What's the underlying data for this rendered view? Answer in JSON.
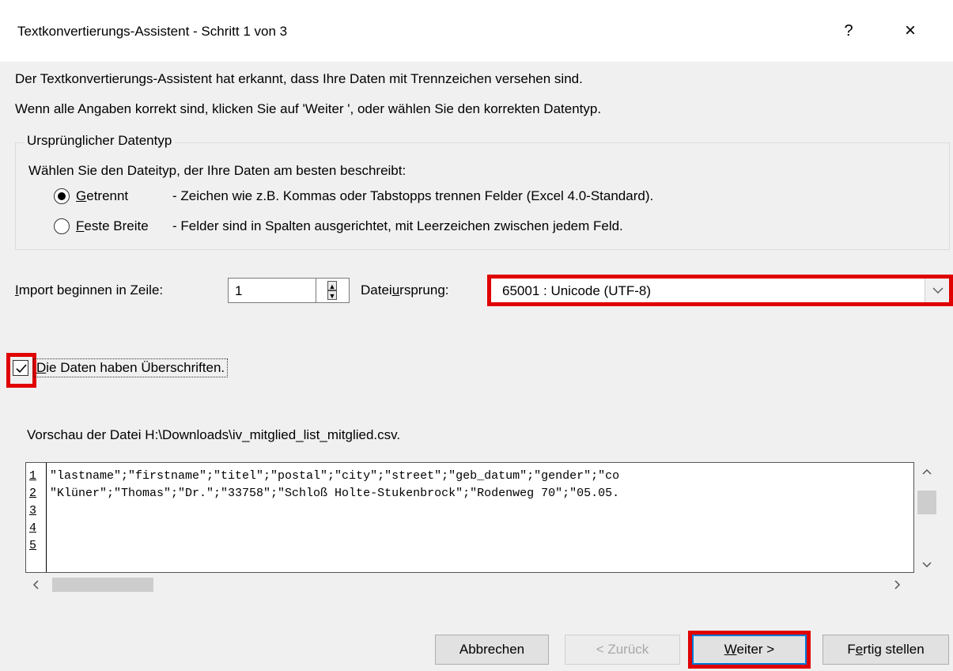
{
  "window": {
    "title": "Textkonvertierungs-Assistent - Schritt 1 von 3",
    "help": "?",
    "close": "×"
  },
  "intro": {
    "line1": "Der Textkonvertierungs-Assistent hat erkannt, dass Ihre Daten mit Trennzeichen versehen sind.",
    "line2": "Wenn alle Angaben korrekt sind, klicken Sie auf 'Weiter ', oder wählen Sie den korrekten Datentyp."
  },
  "datatype": {
    "legend": "Ursprünglicher Datentyp",
    "prompt": "Wählen Sie den Dateityp, der Ihre Daten am besten beschreibt:",
    "options": [
      {
        "key": "G",
        "rest": "etrennt",
        "desc": "- Zeichen wie z.B. Kommas oder Tabstopps trennen Felder (Excel 4.0-Standard).",
        "selected": true
      },
      {
        "key": "F",
        "rest": "este Breite",
        "desc": "- Felder sind in Spalten ausgerichtet, mit Leerzeichen zwischen jedem Feld.",
        "selected": false
      }
    ]
  },
  "import": {
    "label_key": "I",
    "label_rest": "mport beginnen in Zeile:",
    "value": "1"
  },
  "origin": {
    "label_pre": "Datei",
    "label_key": "u",
    "label_post": "rsprung:",
    "value": "65001 : Unicode (UTF-8)"
  },
  "headers": {
    "key": "D",
    "rest": "ie Daten haben Überschriften.",
    "checked": true
  },
  "preview": {
    "label": "Vorschau der Datei H:\\Downloads\\iv_mitglied_list_mitglied.csv.",
    "line_numbers": [
      "1",
      "2",
      "3",
      "4",
      "5"
    ],
    "rows": [
      "\"lastname\";\"firstname\";\"titel\";\"postal\";\"city\";\"street\";\"geb_datum\";\"gender\";\"co",
      "\"Klüner\";\"Thomas\";\"Dr.\";\"33758\";\"Schloß Holte-Stukenbrock\";\"Rodenweg 70\";\"05.05.",
      "",
      "",
      ""
    ]
  },
  "buttons": {
    "cancel": "Abbrechen",
    "back": "< Zurück",
    "next_key": "W",
    "next_rest": "eiter >",
    "finish_pre": "F",
    "finish_key": "e",
    "finish_rest": "rtig stellen"
  },
  "colors": {
    "highlight": "#e00000",
    "focus": "#0078d7"
  }
}
